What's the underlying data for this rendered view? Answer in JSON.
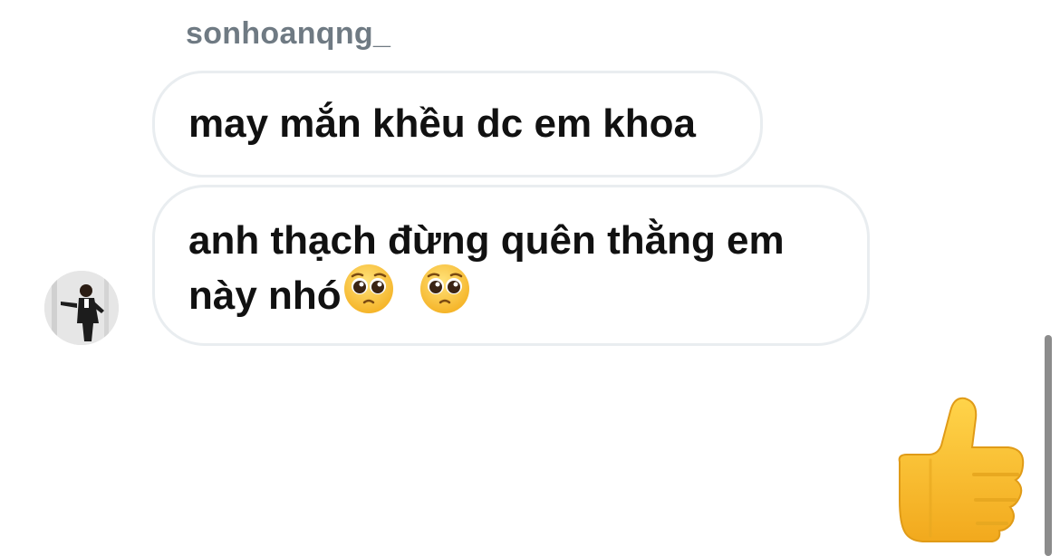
{
  "chat": {
    "sender_name": "sonhoanqng_",
    "messages": [
      {
        "text": "may mắn khều dc em khoa"
      },
      {
        "line1": "anh thạch đừng quên thằng em",
        "line2": "này nhó"
      }
    ],
    "reaction": "thumbs-up"
  },
  "colors": {
    "bubble_border": "#e9edf0",
    "sender_text": "#6f7a83",
    "message_text": "#111111",
    "scrollbar": "#8c8c8c",
    "emoji_yellow": "#fbc02d"
  },
  "icons": [
    "pleading-face-icon",
    "thumbs-up-icon",
    "avatar"
  ]
}
